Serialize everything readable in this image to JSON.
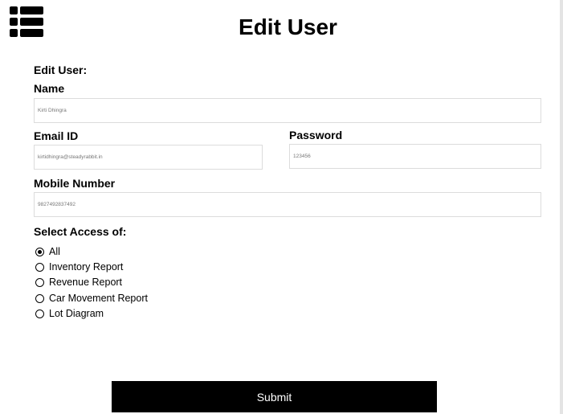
{
  "header": {
    "menu_icon": "list-menu-icon",
    "title": "Edit User"
  },
  "form": {
    "section_heading": "Edit User:",
    "name": {
      "label": "Name",
      "value": "Kirti Dhingra"
    },
    "email": {
      "label": "Email ID",
      "value": "kirtidhingra@steadyrabbit.in"
    },
    "password": {
      "label": "Password",
      "value": "123456"
    },
    "mobile": {
      "label": "Mobile Number",
      "value": "9827492837492"
    },
    "access": {
      "heading": "Select Access of:",
      "options": [
        {
          "label": "All",
          "selected": true
        },
        {
          "label": "Inventory Report",
          "selected": false
        },
        {
          "label": "Revenue Report",
          "selected": false
        },
        {
          "label": "Car Movement Report",
          "selected": false
        },
        {
          "label": "Lot Diagram",
          "selected": false
        }
      ]
    },
    "submit_label": "Submit"
  }
}
